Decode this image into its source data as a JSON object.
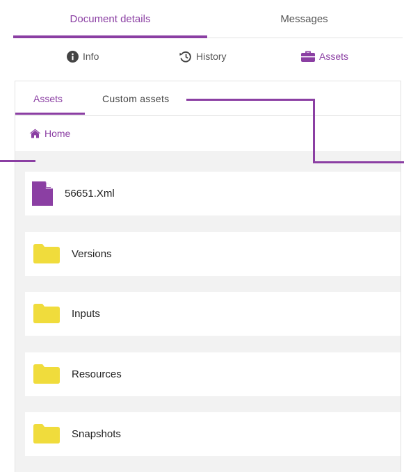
{
  "colors": {
    "accent": "#8b3fa3",
    "folder": "#f0dc3c",
    "file": "#8b3fa3",
    "list_bg": "#f2f2f2"
  },
  "top_tabs": [
    {
      "label": "Document details",
      "active": true
    },
    {
      "label": "Messages",
      "active": false
    }
  ],
  "sub_tabs": [
    {
      "label": "Info",
      "icon": "info-circle-icon",
      "active": false
    },
    {
      "label": "History",
      "icon": "history-icon",
      "active": false
    },
    {
      "label": "Assets",
      "icon": "briefcase-icon",
      "active": true
    }
  ],
  "inner_tabs": [
    {
      "label": "Assets",
      "active": true
    },
    {
      "label": "Custom assets",
      "active": false
    }
  ],
  "breadcrumb": {
    "label": "Home",
    "icon": "home-icon"
  },
  "items": [
    {
      "name": "56651.Xml",
      "type": "file",
      "icon": "file-icon"
    },
    {
      "name": "Versions",
      "type": "folder",
      "icon": "folder-icon"
    },
    {
      "name": "Inputs",
      "type": "folder",
      "icon": "folder-icon"
    },
    {
      "name": "Resources",
      "type": "folder",
      "icon": "folder-icon"
    },
    {
      "name": "Snapshots",
      "type": "folder",
      "icon": "folder-icon"
    }
  ]
}
